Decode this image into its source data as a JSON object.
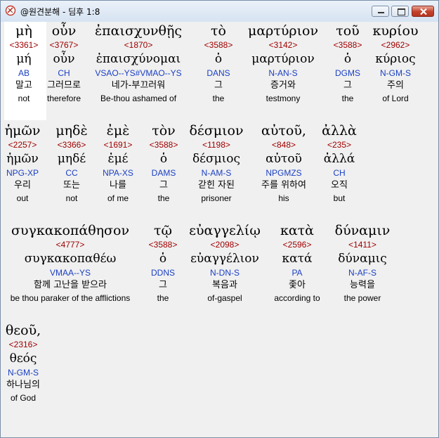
{
  "window": {
    "title": "@원견분해 - 딤후 1:8"
  },
  "words": [
    {
      "greek": "μὴ",
      "strong": "<3361>",
      "lexeme": "μή",
      "parse": "AB",
      "korean": "말고",
      "english": "not"
    },
    {
      "greek": "οὖν",
      "strong": "<3767>",
      "lexeme": "οὖν",
      "parse": "CH",
      "korean": "그러므로",
      "english": "therefore"
    },
    {
      "greek": "ἐπαισχυνθῇς",
      "strong": "<1870>",
      "lexeme": "ἐπαισχύνομαι",
      "parse": "VSAO--YS#VMAO--YS",
      "korean": "네가-부끄러워",
      "english": "Be-thou ashamed of"
    },
    {
      "greek": "τὸ",
      "strong": "<3588>",
      "lexeme": "ὁ",
      "parse": "DANS",
      "korean": "그",
      "english": "the"
    },
    {
      "greek": "μαρτύριον",
      "strong": "<3142>",
      "lexeme": "μαρτύριον",
      "parse": "N-AN-S",
      "korean": "증거와",
      "english": "testmony"
    },
    {
      "greek": "τοῦ",
      "strong": "<3588>",
      "lexeme": "ὁ",
      "parse": "DGMS",
      "korean": "그",
      "english": "the"
    },
    {
      "greek": "κυρίου",
      "strong": "<2962>",
      "lexeme": "κύριος",
      "parse": "N-GM-S",
      "korean": "주의",
      "english": "of Lord"
    },
    {
      "greek": "ἡμῶν",
      "strong": "<2257>",
      "lexeme": "ἡμῶν",
      "parse": "NPG-XP",
      "korean": "우리",
      "english": "out"
    },
    {
      "greek": "μηδὲ",
      "strong": "<3366>",
      "lexeme": "μηδέ",
      "parse": "CC",
      "korean": "또는",
      "english": "not"
    },
    {
      "greek": "ἐμὲ",
      "strong": "<1691>",
      "lexeme": "ἐμέ",
      "parse": "NPA-XS",
      "korean": "나를",
      "english": "of me"
    },
    {
      "greek": "τὸν",
      "strong": "<3588>",
      "lexeme": "ὁ",
      "parse": "DAMS",
      "korean": "그",
      "english": "the"
    },
    {
      "greek": "δέσμιον",
      "strong": "<1198>",
      "lexeme": "δέσμιος",
      "parse": "N-AM-S",
      "korean": "갇힌 자된",
      "english": "prisoner"
    },
    {
      "greek": "αὐτοῦ,",
      "strong": "<848>",
      "lexeme": "αὐτοῦ",
      "parse": "NPGMZS",
      "korean": "주를 위하여",
      "english": "his"
    },
    {
      "greek": "ἀλλὰ",
      "strong": "<235>",
      "lexeme": "ἀλλά",
      "parse": "CH",
      "korean": "오직",
      "english": "but"
    },
    {
      "greek": "συγκακοπάθησον",
      "strong": "<4777>",
      "lexeme": "συγκακοπαθέω",
      "parse": "VMAA--YS",
      "korean": "함께 고난을 받으라",
      "english": "be thou paraker of the afflictions"
    },
    {
      "greek": "τῷ",
      "strong": "<3588>",
      "lexeme": "ὁ",
      "parse": "DDNS",
      "korean": "그",
      "english": "the"
    },
    {
      "greek": "εὐαγγελίῳ",
      "strong": "<2098>",
      "lexeme": "εὐαγγέλιον",
      "parse": "N-DN-S",
      "korean": "복음과",
      "english": "of-gaspel"
    },
    {
      "greek": "κατὰ",
      "strong": "<2596>",
      "lexeme": "κατά",
      "parse": "PA",
      "korean": "좇아",
      "english": "according to"
    },
    {
      "greek": "δύναμιν",
      "strong": "<1411>",
      "lexeme": "δύναμις",
      "parse": "N-AF-S",
      "korean": "능력을",
      "english": "the power"
    },
    {
      "greek": "θεοῦ,",
      "strong": "<2316>",
      "lexeme": "θεός",
      "parse": "N-GM-S",
      "korean": "하나님의",
      "english": "of God"
    }
  ],
  "colors": {
    "strong": "#a00000",
    "parse": "#1a3fc2",
    "selected_bg": "#ffffff"
  }
}
